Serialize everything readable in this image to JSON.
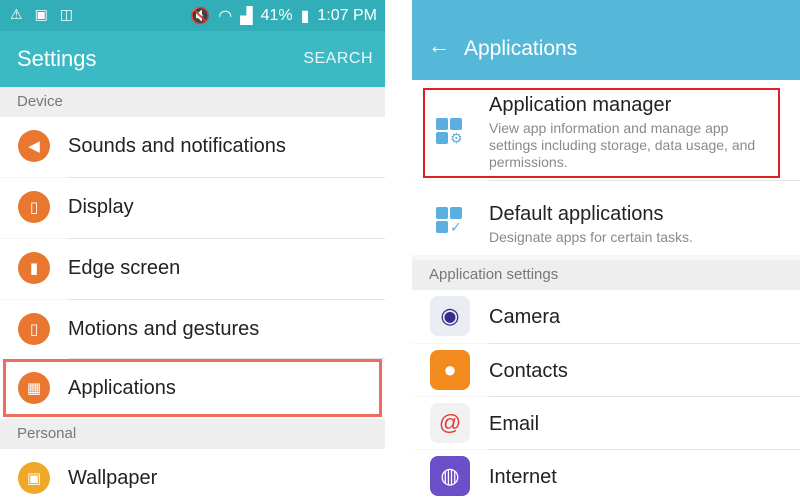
{
  "left": {
    "status_bar": {
      "battery_percent": "41%",
      "time": "1:07 PM"
    },
    "app_bar": {
      "title": "Settings",
      "search_label": "SEARCH"
    },
    "sections": [
      {
        "header": "Device",
        "items": [
          {
            "label": "Sounds and notifications",
            "icon": "volume-icon"
          },
          {
            "label": "Display",
            "icon": "display-icon"
          },
          {
            "label": "Edge screen",
            "icon": "edge-screen-icon"
          },
          {
            "label": "Motions and gestures",
            "icon": "motions-icon"
          },
          {
            "label": "Applications",
            "icon": "applications-icon"
          }
        ]
      },
      {
        "header": "Personal",
        "items": [
          {
            "label": "Wallpaper",
            "icon": "wallpaper-icon"
          }
        ]
      }
    ]
  },
  "right": {
    "app_bar": {
      "title": "Applications"
    },
    "top_items": [
      {
        "title": "Application manager",
        "description": "View app information and manage app settings including storage, data usage, and permissions."
      },
      {
        "title": "Default applications",
        "description": "Designate apps for certain tasks."
      }
    ],
    "section_header": "Application settings",
    "apps": [
      {
        "label": "Camera",
        "icon": "camera-icon"
      },
      {
        "label": "Contacts",
        "icon": "contacts-icon"
      },
      {
        "label": "Email",
        "icon": "email-icon"
      },
      {
        "label": "Internet",
        "icon": "internet-icon"
      }
    ]
  },
  "colors": {
    "status_bar": "#32aeb9",
    "settings_app_bar": "#3bbac5",
    "applications_app_bar": "#55b8d9",
    "icon_orange": "#e9772f",
    "highlight_left": "#ee6d5f",
    "highlight_right": "#e02025"
  }
}
